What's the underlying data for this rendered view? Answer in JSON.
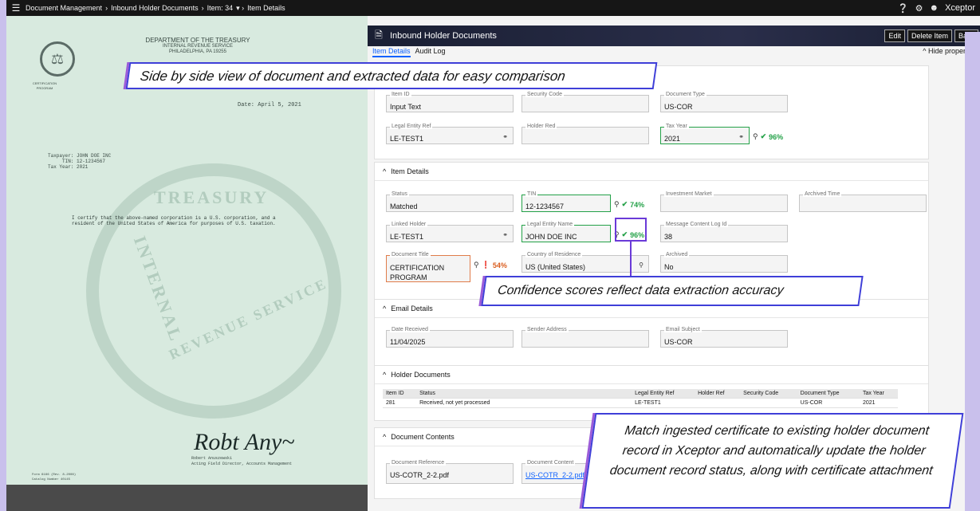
{
  "topbar": {
    "crumbs": [
      "Document Management",
      "Inbound Holder Documents",
      "Item: 34",
      "Item Details"
    ],
    "app": "Xceptor"
  },
  "doc": {
    "dept": "DEPARTMENT OF THE TREASURY",
    "irs": "INTERNAL REVENUE SERVICE",
    "city": "PHILADELPHIA, PA 19255",
    "cert": "CERTIFICATION",
    "program": "PROGRAM",
    "date": "Date: April 5, 2021",
    "taxpayer": "Taxpayer: JOHN DOE INC",
    "tin": "     TIN: 12-1234567",
    "taxyear": "Tax Year: 2021",
    "body": "I certify that the above-named corporation is a U.S. corporation, and a\nresident of the United States of America for purposes of U.S. taxation.",
    "signer": "Robert Anuszewski",
    "signer_title": "Acting Field Director, Accounts Management",
    "form": "Form 6166 (Rev. 8-2008)",
    "catalog": "Catalog Number 40145",
    "water1": "TREASURY",
    "water2": "INTERNAL",
    "water3": "REVENUE SERVICE",
    "signature": "Robert Anuszewski"
  },
  "header": {
    "title": "Inbound Holder Documents",
    "edit": "Edit",
    "delete": "Delete Item",
    "back": "Back"
  },
  "tabs": {
    "details": "Item Details",
    "audit": "Audit Log",
    "hide": "Hide properties"
  },
  "top": {
    "item_id_label": "Item ID",
    "item_id": "Input Text",
    "security_label": "Security Code",
    "doctype_label": "Document Type",
    "doctype": "US-COR",
    "ler_label": "Legal Entity Ref",
    "ler": "LE-TEST1",
    "holder_label": "Holder Red",
    "taxyear_label": "Tax Year",
    "taxyear": "2021",
    "taxyear_conf": "96%"
  },
  "item_details": {
    "title": "Item Details",
    "status_label": "Status",
    "status": "Matched",
    "tin_label": "TIN",
    "tin": "12-1234567",
    "tin_conf": "74%",
    "market_label": "Investment Market",
    "archived_time_label": "Archived Time",
    "linked_label": "Linked Holder",
    "linked": "LE-TEST1",
    "lename_label": "Legal Entity Name",
    "lename": "JOHN DOE INC",
    "lename_conf": "96%",
    "msglog_label": "Message Content Log Id",
    "msglog": "38",
    "doctitle_label": "Document Title",
    "doctitle": "CERTIFICATION PROGRAM",
    "doctitle_conf": "54%",
    "country_label": "Country of Residence",
    "country": "US (United States)",
    "archived_label": "Archived",
    "archived": "No"
  },
  "email": {
    "title": "Email Details",
    "date_label": "Date Received",
    "date": "11/04/2025",
    "sender_label": "Sender Address",
    "subject_label": "Email Subject",
    "subject": "US-COR"
  },
  "holder": {
    "title": "Holder Documents",
    "columns": [
      "Item ID",
      "Status",
      "Legal Entity Ref",
      "Holder Ref",
      "Security Code",
      "Document Type",
      "Tax Year"
    ],
    "row": [
      "281",
      "Received, not yet processed",
      "LE-TEST1",
      "",
      "",
      "US-COR",
      "2021"
    ]
  },
  "contents": {
    "title": "Document Contents",
    "ref_label": "Document Reference",
    "ref": "US-COTR_2-2.pdf",
    "content_label": "Document Content",
    "content": "US-COTR_2-2.pdf"
  },
  "callouts": {
    "c1": "Side by side view of document and extracted data for easy comparison",
    "c2": "Confidence scores reflect data extraction accuracy",
    "c3": "Match ingested certificate to existing holder document record in Xceptor and automatically update the holder document record status, along with certificate attachment"
  }
}
